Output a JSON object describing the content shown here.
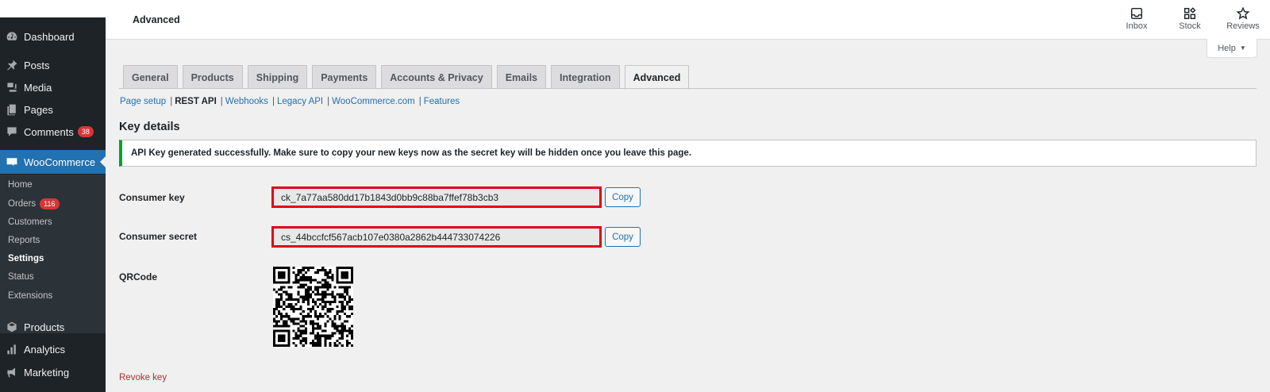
{
  "header": {
    "title": "Advanced",
    "actions": [
      {
        "label": "Inbox",
        "icon": "inbox-icon"
      },
      {
        "label": "Stock",
        "icon": "stock-icon"
      },
      {
        "label": "Reviews",
        "icon": "star-icon"
      }
    ],
    "help_label": "Help"
  },
  "sidebar": {
    "items": [
      {
        "label": "Dashboard",
        "icon": "dashboard-icon"
      },
      {
        "label": "Posts",
        "icon": "pin-icon"
      },
      {
        "label": "Media",
        "icon": "media-icon"
      },
      {
        "label": "Pages",
        "icon": "pages-icon"
      },
      {
        "label": "Comments",
        "icon": "comments-icon",
        "badge": "38"
      },
      {
        "label": "WooCommerce",
        "icon": "woo-icon"
      },
      {
        "label": "Products",
        "icon": "products-icon"
      },
      {
        "label": "Analytics",
        "icon": "analytics-icon"
      },
      {
        "label": "Marketing",
        "icon": "megaphone-icon"
      }
    ],
    "submenu": [
      {
        "label": "Home"
      },
      {
        "label": "Orders",
        "badge": "116"
      },
      {
        "label": "Customers"
      },
      {
        "label": "Reports"
      },
      {
        "label": "Settings"
      },
      {
        "label": "Status"
      },
      {
        "label": "Extensions"
      }
    ]
  },
  "tabs": [
    "General",
    "Products",
    "Shipping",
    "Payments",
    "Accounts & Privacy",
    "Emails",
    "Integration",
    "Advanced"
  ],
  "active_tab": "Advanced",
  "subsub": {
    "page_setup": "Page setup",
    "rest_api": "REST API",
    "webhooks": "Webhooks",
    "legacy_api": "Legacy API",
    "woocommerce_com": "WooCommerce.com",
    "features": "Features",
    "sep": "|"
  },
  "main": {
    "section_title": "Key details",
    "notice": "API Key generated successfully. Make sure to copy your new keys now as the secret key will be hidden once you leave this page.",
    "consumer_key_label": "Consumer key",
    "consumer_key_value": "ck_7a77aa580dd17b1843d0bb9c88ba7ffef78b3cb3",
    "consumer_secret_label": "Consumer secret",
    "consumer_secret_value": "cs_44bccfcf567acb107e0380a2862b444733074226",
    "copy_label": "Copy",
    "qrcode_label": "QRCode",
    "revoke_label": "Revoke key"
  },
  "colors": {
    "sidebar_bg": "#1d2327",
    "accent": "#2271b1",
    "highlight_border": "#e0001b",
    "badge": "#d63638",
    "notice_success": "#00a32a",
    "revoke": "#b32d2e"
  }
}
